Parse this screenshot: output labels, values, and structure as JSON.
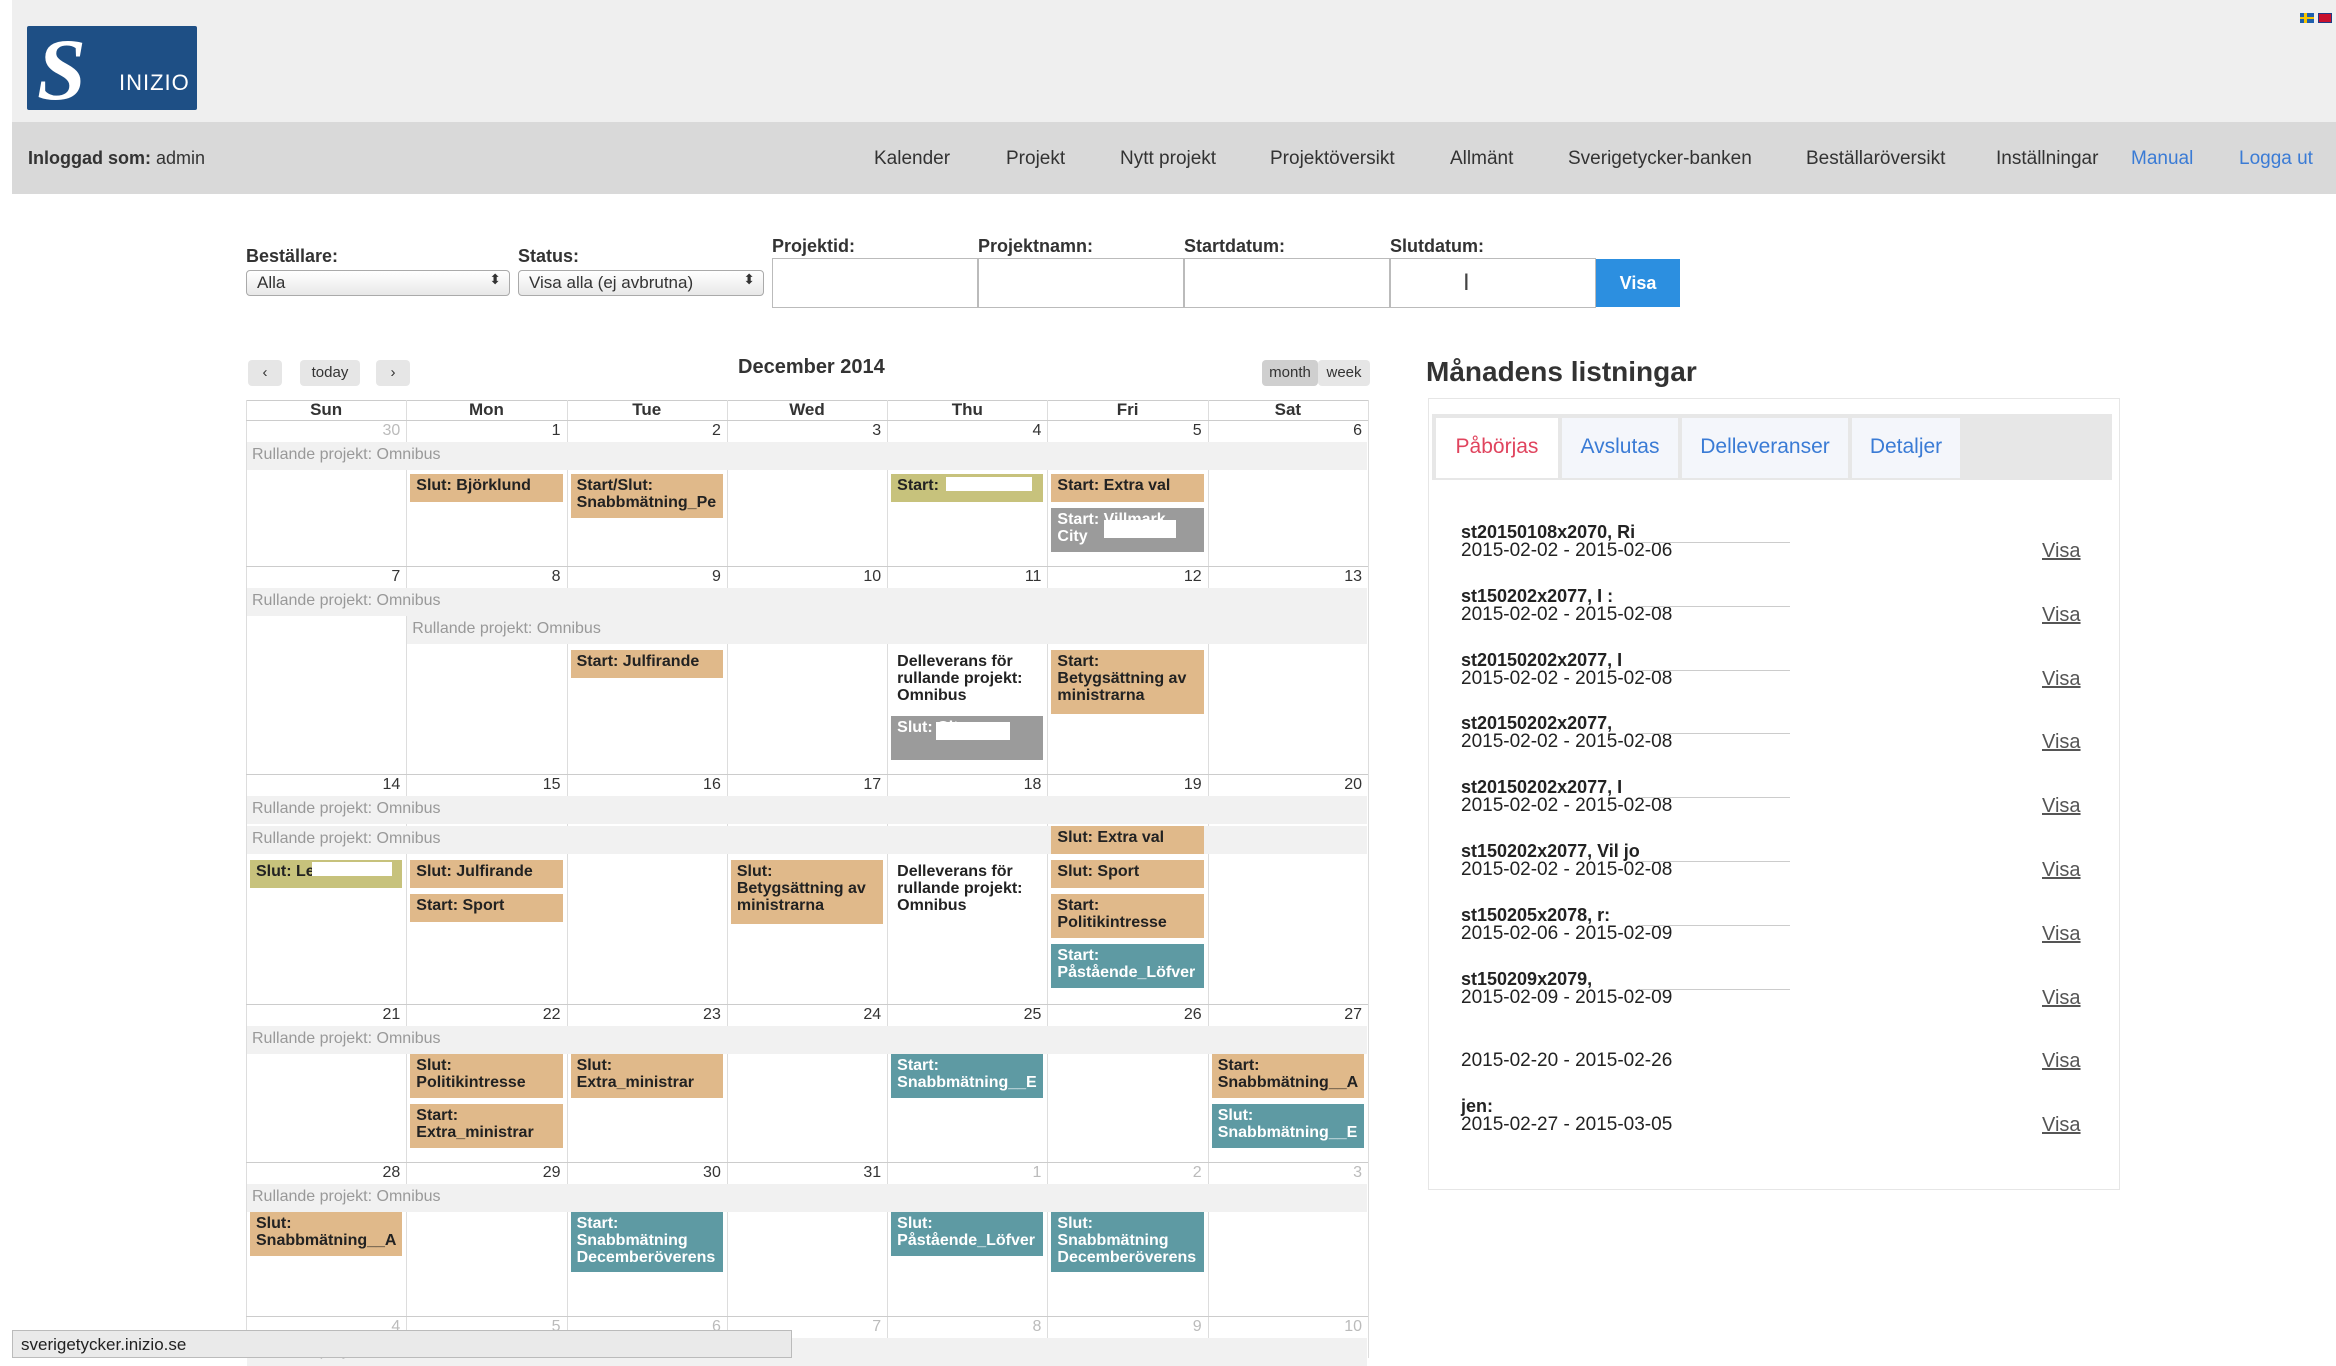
{
  "header": {
    "logo_text": "INIZIO",
    "logo_mark": "S",
    "logged_label": "Inloggad som:",
    "logged_user": "admin",
    "nav": [
      "Kalender",
      "Projekt",
      "Nytt projekt",
      "Projektöversikt",
      "Allmänt",
      "Sverigetycker-banken",
      "Beställaröversikt",
      "Inställningar"
    ],
    "nav_links": [
      "Manual",
      "Logga ut"
    ]
  },
  "filters": {
    "bestallare_label": "Beställare:",
    "bestallare_value": "Alla",
    "status_label": "Status:",
    "status_value": "Visa alla (ej avbrutna)",
    "projekttid_label": "Projektid:",
    "projektnamn_label": "Projektnamn:",
    "startdatum_label": "Startdatum:",
    "slutdatum_label": "Slutdatum:",
    "visa_button": "Visa"
  },
  "calendar": {
    "title": "December 2014",
    "today_label": "today",
    "month_label": "month",
    "week_label": "week",
    "weekdays": [
      "Sun",
      "Mon",
      "Tue",
      "Wed",
      "Thu",
      "Fri",
      "Sat"
    ],
    "weeks": [
      [
        "30",
        "1",
        "2",
        "3",
        "4",
        "5",
        "6"
      ],
      [
        "7",
        "8",
        "9",
        "10",
        "11",
        "12",
        "13"
      ],
      [
        "14",
        "15",
        "16",
        "17",
        "18",
        "19",
        "20"
      ],
      [
        "21",
        "22",
        "23",
        "24",
        "25",
        "26",
        "27"
      ],
      [
        "28",
        "29",
        "30",
        "31",
        "1",
        "2",
        "3"
      ],
      [
        "4",
        "5",
        "6",
        "7",
        "8",
        "9",
        "10"
      ]
    ],
    "rullande": "Rullande projekt: Omnibus",
    "events": {
      "e1": "Slut: Björklund",
      "e2": "Start/Slut: Snabbmätning_Pe",
      "e3": "Start:",
      "e4": "Start: Extra val",
      "e5": "Start: Villmark City",
      "e6": "Start: Julfirande",
      "e7": "Delleverans för rullande projekt: Omnibus",
      "e8": "Start: Betygsättning av ministrarna",
      "e9": "Slut: City",
      "e10": "Slut: Let's Dance",
      "e11": "Slut: Julfirande",
      "e12": "Start: Sport",
      "e13": "Slut: Betygsättning av ministrarna",
      "e14": "Delleverans för rullande projekt: Omnibus",
      "e15": "Slut: Extra val",
      "e16": "Slut: Sport",
      "e17": "Start: Politikintresse",
      "e18": "Start: Påstående_Löfver",
      "e19": "Slut: Politikintresse",
      "e20": "Start: Extra_ministrar",
      "e21": "Slut: Extra_ministrar",
      "e22": "Start: Snabbmätning__E",
      "e23": "Start: Snabbmätning__A",
      "e24": "Slut: Snabbmätning__E",
      "e25": "Slut: Snabbmätning__A",
      "e26": "Start: Snabbmätning Decemberöverens",
      "e27": "Slut: Påstående_Löfver",
      "e28": "Slut: Snabbmätning Decemberöverens"
    }
  },
  "panel": {
    "title": "Månadens listningar",
    "tabs": [
      "Påbörjas",
      "Avslutas",
      "Delleveranser",
      "Detaljer"
    ],
    "visa": "Visa",
    "items": [
      {
        "title": "st20150108x2070, Ri          er :",
        "dates": "2015-02-02 - 2015-02-06"
      },
      {
        "title": "st150202x2077, I                  :",
        "dates": "2015-02-02 - 2015-02-08"
      },
      {
        "title": "st20150202x2077, I",
        "dates": "2015-02-02 - 2015-02-08"
      },
      {
        "title": "st20150202x2077,",
        "dates": "2015-02-02 - 2015-02-08"
      },
      {
        "title": "st20150202x2077, I",
        "dates": "2015-02-02 - 2015-02-08"
      },
      {
        "title": "st150202x2077, Vil                     jor:",
        "dates": "2015-02-02 - 2015-02-08"
      },
      {
        "title": "st150205x2078,                              r:",
        "dates": "2015-02-06 - 2015-02-09"
      },
      {
        "title": "st150209x2079,",
        "dates": "2015-02-09 - 2015-02-09"
      },
      {
        "title": "",
        "dates": "2015-02-20 - 2015-02-26"
      },
      {
        "title": "jen:",
        "dates": "2015-02-27 - 2015-03-05"
      }
    ]
  },
  "status_bar": "sverigetycker.inizio.se",
  "colors": {
    "tan": "#e0b98a",
    "teal": "#5e9aa3",
    "accent": "#2c8fe0",
    "tab_active": "#e0445e"
  }
}
